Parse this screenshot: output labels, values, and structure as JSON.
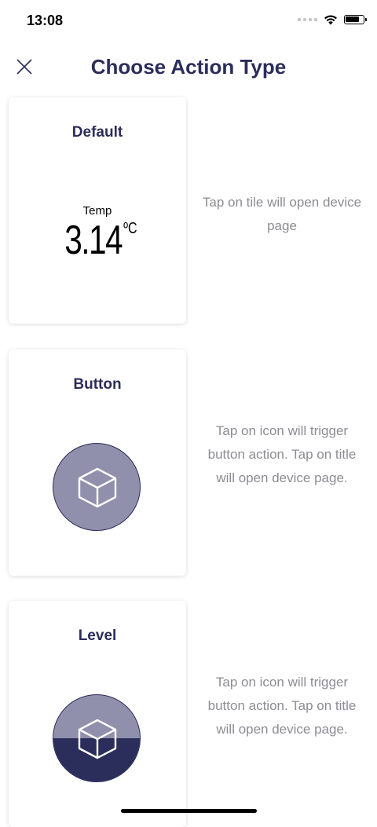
{
  "status": {
    "time": "13:08"
  },
  "header": {
    "title": "Choose Action Type",
    "close_icon": "close-icon"
  },
  "cards": {
    "default": {
      "title": "Default",
      "sensor_label": "Temp",
      "sensor_value": "3.14",
      "sensor_unit": "ºC",
      "description": "Tap on tile will open device page"
    },
    "button": {
      "title": "Button",
      "icon": "cube-icon",
      "description": "Tap on icon will trigger button action. Tap on title will open device page."
    },
    "level": {
      "title": "Level",
      "icon": "cube-icon",
      "level_fraction": 0.5,
      "description": "Tap on icon will trigger button action. Tap on title will open device page."
    }
  },
  "colors": {
    "primary": "#2b2d5a",
    "icon_background": "#9090ac",
    "description_text": "#8c8c94"
  }
}
